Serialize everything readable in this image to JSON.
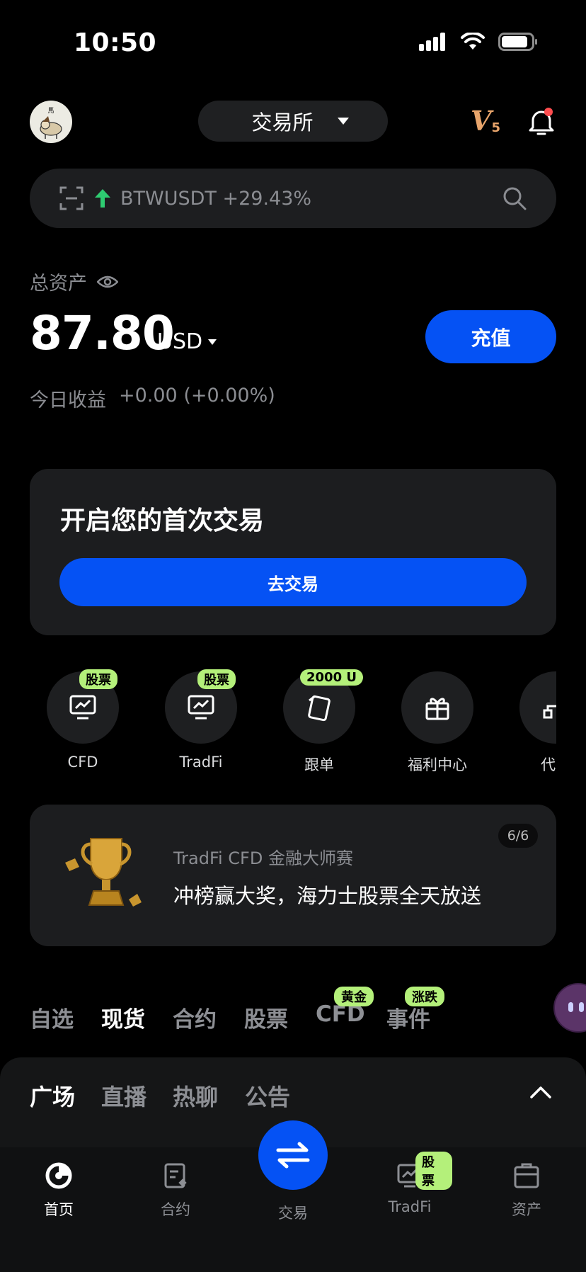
{
  "status_bar": {
    "time": "10:50"
  },
  "header": {
    "exchange_label": "交易所",
    "vip_level": "V",
    "vip_number": "5"
  },
  "search": {
    "ticker": "BTWUSDT +29.43%",
    "ticker_color": "#2ecc71"
  },
  "assets": {
    "label": "总资产",
    "balance": "87.80",
    "currency": "USD",
    "deposit_label": "充值",
    "today_label": "今日收益",
    "today_value": "+0.00 (+0.00%)"
  },
  "first_trade": {
    "title": "开启您的首次交易",
    "button": "去交易"
  },
  "quick_actions": [
    {
      "label": "CFD",
      "badge": "股票",
      "icon": "chart-monitor-icon"
    },
    {
      "label": "TradFi",
      "badge": "股票",
      "icon": "chart-monitor-icon"
    },
    {
      "label": "跟单",
      "badge": "2000 U",
      "icon": "cards-icon"
    },
    {
      "label": "福利中心",
      "badge": "",
      "icon": "gift-icon"
    },
    {
      "label": "代理",
      "badge": "",
      "icon": "network-icon"
    }
  ],
  "promo": {
    "subtitle": "TradFi CFD 金融大师赛",
    "headline": "冲榜赢大奖，海力士股票全天放送",
    "page": "6/6"
  },
  "market_tabs": [
    {
      "label": "自选",
      "badge": ""
    },
    {
      "label": "现货",
      "badge": ""
    },
    {
      "label": "合约",
      "badge": ""
    },
    {
      "label": "股票",
      "badge": ""
    },
    {
      "label": "CFD",
      "badge": "黄金"
    },
    {
      "label": "事件",
      "badge": "涨跌"
    }
  ],
  "feed_tabs": [
    "广场",
    "直播",
    "热聊",
    "公告"
  ],
  "bottom_nav": [
    {
      "label": "首页",
      "badge": ""
    },
    {
      "label": "合约",
      "badge": ""
    },
    {
      "label": "交易",
      "badge": ""
    },
    {
      "label": "TradFi",
      "badge": "股票"
    },
    {
      "label": "资产",
      "badge": ""
    }
  ],
  "colors": {
    "accent": "#0552f4",
    "badge": "#b4f07a",
    "vip": "#e8a46b",
    "notification_dot": "#ff4d4f"
  }
}
